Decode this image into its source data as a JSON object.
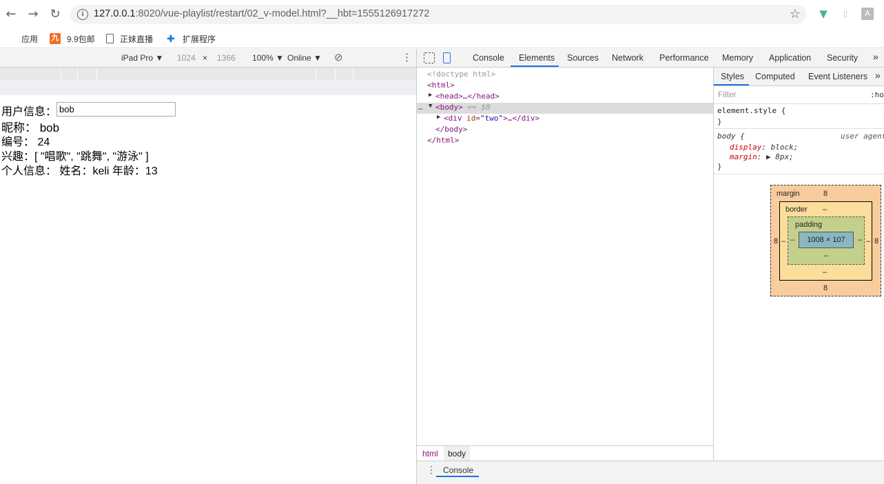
{
  "browser": {
    "url_host": "127.0.0.1",
    "url_rest": ":8020/vue-playlist/restart/02_v-model.html?__hbt=1555126917272",
    "bookmarks": [
      {
        "label": "应用",
        "icon": "apps-grid-icon"
      },
      {
        "label": "9.9包邮",
        "icon": "jiu-logo-icon",
        "icon_text": "九"
      },
      {
        "label": "正妹直播",
        "icon": "page-icon"
      },
      {
        "label": "扩展程序",
        "icon": "puzzle-icon"
      }
    ]
  },
  "device_toolbar": {
    "device": "iPad Pro ▼",
    "width": "1024",
    "times": "×",
    "height": "1366",
    "zoom": "100% ▼",
    "throttle": "Online ▼"
  },
  "page": {
    "user_label": "用户信息：",
    "user_value": "bob",
    "nickname": "昵称： bob",
    "id": "编号： 24",
    "hobbies": "兴趣：[ \"唱歌\", \"跳舞\", \"游泳\" ]",
    "personal": "个人信息： 姓名：keli 年龄：13"
  },
  "devtools": {
    "tabs": [
      "Console",
      "Elements",
      "Sources",
      "Network",
      "Performance",
      "Memory",
      "Application",
      "Security"
    ],
    "active_tab": "Elements",
    "dom": {
      "doctype": "<!doctype html>",
      "html_open": "<html>",
      "head": "<head>…</head>",
      "body_open": "<body>",
      "body_suffix": " == $0",
      "div_open_a": "<div ",
      "div_attr": "id",
      "div_val": "\"two\"",
      "div_close": ">…</div>",
      "body_close": "</body>",
      "html_close": "</html>"
    },
    "styles_tabs": [
      "Styles",
      "Computed",
      "Event Listeners"
    ],
    "filter_placeholder": "Filter",
    "hov": ":hov",
    "element_style": "element.style {",
    "close_brace": "}",
    "body_rule": "body {",
    "user_agent": "user agent",
    "rule_display_prop": "display",
    "rule_display_val": "block;",
    "rule_margin_prop": "margin",
    "rule_margin_val": "8px;",
    "box_model": {
      "margin_label": "margin",
      "margin": "8",
      "border_label": "border",
      "border": "–",
      "padding_label": "padding",
      "padding": "–",
      "content": "1008 × 107"
    },
    "breadcrumbs": [
      "html",
      "body"
    ],
    "drawer_tab": "Console"
  },
  "colors": {
    "accent": "#1a73e8",
    "tag": "#881280",
    "margin_box": "#f9cc9d",
    "border_box": "#fddd9b",
    "padding_box": "#c3d08b",
    "content_box": "#8cb6c0"
  }
}
